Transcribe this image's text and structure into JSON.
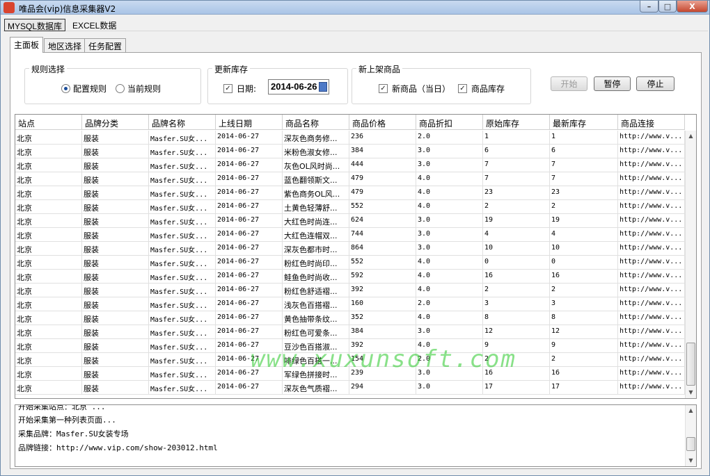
{
  "window": {
    "title": "唯品会(vip)信息采集器V2",
    "min": "–",
    "max": "□",
    "close": "X"
  },
  "menu": [
    "MYSQL数据库",
    "EXCEL数据"
  ],
  "tabs": [
    "主面板",
    "地区选择",
    "任务配置"
  ],
  "rule_group": {
    "label": "规则选择",
    "options": [
      {
        "label": "配置规则",
        "selected": true
      },
      {
        "label": "当前规则",
        "selected": false
      }
    ]
  },
  "stock_group": {
    "label": "更新库存",
    "date_label": "日期:",
    "date_checked": true,
    "date_value": "2014-06-26"
  },
  "new_group": {
    "label": "新上架商品",
    "options": [
      {
        "label": "新商品（当日）",
        "checked": true
      },
      {
        "label": "商品库存",
        "checked": true
      }
    ]
  },
  "buttons": {
    "start": "开始",
    "pause": "暂停",
    "stop": "停止"
  },
  "table": {
    "columns": [
      "站点",
      "品牌分类",
      "品牌名称",
      "上线日期",
      "商品名称",
      "商品价格",
      "商品折扣",
      "原始库存",
      "最新库存",
      "商品连接"
    ],
    "rows": [
      [
        "北京",
        "服装",
        "Masfer.SU女...",
        "2014-06-27",
        "深灰色商务修...",
        "236",
        "2.0",
        "1",
        "1",
        "http://www.v..."
      ],
      [
        "北京",
        "服装",
        "Masfer.SU女...",
        "2014-06-27",
        "米粉色淑女修...",
        "384",
        "3.0",
        "6",
        "6",
        "http://www.v..."
      ],
      [
        "北京",
        "服装",
        "Masfer.SU女...",
        "2014-06-27",
        "灰色OL风时尚...",
        "444",
        "3.0",
        "7",
        "7",
        "http://www.v..."
      ],
      [
        "北京",
        "服装",
        "Masfer.SU女...",
        "2014-06-27",
        "蓝色翻领斯文...",
        "479",
        "4.0",
        "7",
        "7",
        "http://www.v..."
      ],
      [
        "北京",
        "服装",
        "Masfer.SU女...",
        "2014-06-27",
        "紫色商务OL风...",
        "479",
        "4.0",
        "23",
        "23",
        "http://www.v..."
      ],
      [
        "北京",
        "服装",
        "Masfer.SU女...",
        "2014-06-27",
        "土黄色轻薄舒...",
        "552",
        "4.0",
        "2",
        "2",
        "http://www.v..."
      ],
      [
        "北京",
        "服装",
        "Masfer.SU女...",
        "2014-06-27",
        "大红色时尚连...",
        "624",
        "3.0",
        "19",
        "19",
        "http://www.v..."
      ],
      [
        "北京",
        "服装",
        "Masfer.SU女...",
        "2014-06-27",
        "大红色连帽双...",
        "744",
        "3.0",
        "4",
        "4",
        "http://www.v..."
      ],
      [
        "北京",
        "服装",
        "Masfer.SU女...",
        "2014-06-27",
        "深灰色都市时...",
        "864",
        "3.0",
        "10",
        "10",
        "http://www.v..."
      ],
      [
        "北京",
        "服装",
        "Masfer.SU女...",
        "2014-06-27",
        "粉红色时尚印...",
        "552",
        "4.0",
        "0",
        "0",
        "http://www.v..."
      ],
      [
        "北京",
        "服装",
        "Masfer.SU女...",
        "2014-06-27",
        "鲑鱼色时尚收...",
        "592",
        "4.0",
        "16",
        "16",
        "http://www.v..."
      ],
      [
        "北京",
        "服装",
        "Masfer.SU女...",
        "2014-06-27",
        "粉红色舒适褶...",
        "392",
        "4.0",
        "2",
        "2",
        "http://www.v..."
      ],
      [
        "北京",
        "服装",
        "Masfer.SU女...",
        "2014-06-27",
        "浅灰色百搭褶...",
        "160",
        "2.0",
        "3",
        "3",
        "http://www.v..."
      ],
      [
        "北京",
        "服装",
        "Masfer.SU女...",
        "2014-06-27",
        "黄色抽带条纹...",
        "352",
        "4.0",
        "8",
        "8",
        "http://www.v..."
      ],
      [
        "北京",
        "服装",
        "Masfer.SU女...",
        "2014-06-27",
        "粉红色可爱条...",
        "384",
        "3.0",
        "12",
        "12",
        "http://www.v..."
      ],
      [
        "北京",
        "服装",
        "Masfer.SU女...",
        "2014-06-27",
        "豆沙色百搭淑...",
        "392",
        "4.0",
        "9",
        "9",
        "http://www.v..."
      ],
      [
        "北京",
        "服装",
        "Masfer.SU女...",
        "2014-06-27",
        "啡绿色百搭一...",
        "154",
        "2.0",
        "2",
        "2",
        "http://www.v..."
      ],
      [
        "北京",
        "服装",
        "Masfer.SU女...",
        "2014-06-27",
        "军绿色拼接时...",
        "239",
        "3.0",
        "16",
        "16",
        "http://www.v..."
      ],
      [
        "北京",
        "服装",
        "Masfer.SU女...",
        "2014-06-27",
        "深灰色气质褶...",
        "294",
        "3.0",
        "17",
        "17",
        "http://www.v..."
      ]
    ]
  },
  "watermark": "www.xuxunsoft.com",
  "log": {
    "lines": [
      "开始采集站点：北京 ...",
      "开始采集第一种列表页面...",
      "采集品牌：Masfer.SU女装专场",
      "品牌链接：http://www.vip.com/show-203012.html"
    ]
  },
  "scroll": {
    "up": "▲",
    "down": "▼"
  }
}
